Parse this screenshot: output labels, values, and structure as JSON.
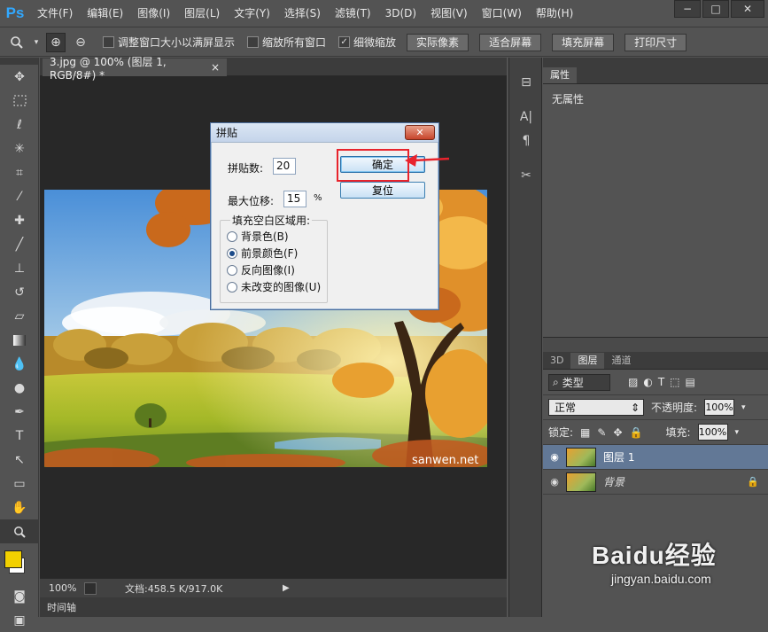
{
  "menubar": {
    "logo": "Ps",
    "items": [
      "文件(F)",
      "编辑(E)",
      "图像(I)",
      "图层(L)",
      "文字(Y)",
      "选择(S)",
      "滤镜(T)",
      "3D(D)",
      "视图(V)",
      "窗口(W)",
      "帮助(H)"
    ],
    "window_buttons": [
      "−",
      "□",
      "✕"
    ]
  },
  "options": {
    "zoom_in_icon": "⊕",
    "zoom_out_icon": "⊖",
    "resize_windows_label": "调整窗口大小以满屏显示",
    "zoom_all_label": "缩放所有窗口",
    "scrubby_zoom_label": "细微缩放",
    "actual_pixels_label": "实际像素",
    "fit_screen_label": "适合屏幕",
    "fill_screen_label": "填充屏幕",
    "print_size_label": "打印尺寸"
  },
  "document": {
    "tab_title": "3.jpg @ 100% (图层 1, RGB/8#) *",
    "tab_close": "×",
    "watermark": "sanwen.net",
    "zoom": "100%",
    "doc_info": "文档:458.5 K/917.0K",
    "timeline_label": "时间轴"
  },
  "dialog": {
    "title": "拼贴",
    "close_label": "✕",
    "tiles_label": "拼贴数:",
    "tiles_value": "20",
    "max_offset_label": "最大位移:",
    "max_offset_value": "15",
    "percent": "%",
    "ok_label": "确定",
    "reset_label": "复位",
    "group_label": "填充空白区域用:",
    "options": [
      {
        "label": "背景色(B)",
        "checked": false
      },
      {
        "label": "前景颜色(F)",
        "checked": true
      },
      {
        "label": "反向图像(I)",
        "checked": false
      },
      {
        "label": "未改变的图像(U)",
        "checked": false
      }
    ]
  },
  "properties": {
    "tab_label": "属性",
    "content": "无属性"
  },
  "layers_panel": {
    "tabs": [
      "3D",
      "图层",
      "通道"
    ],
    "filter_label": "类型",
    "blend_mode": "正常",
    "opacity_label": "不透明度:",
    "opacity_value": "100%",
    "lock_label": "锁定:",
    "fill_label": "填充:",
    "fill_value": "100%",
    "layers": [
      {
        "name": "图层 1",
        "selected": true,
        "locked": false
      },
      {
        "name": "背景",
        "selected": false,
        "locked": true
      }
    ]
  },
  "brand_watermark": {
    "logo": "Baidu经验",
    "url": "jingyan.baidu.com"
  },
  "colors": {
    "accent_red": "#e8232c",
    "foreground_swatch": "#f2d000",
    "ps_blue": "#31a8ff"
  }
}
